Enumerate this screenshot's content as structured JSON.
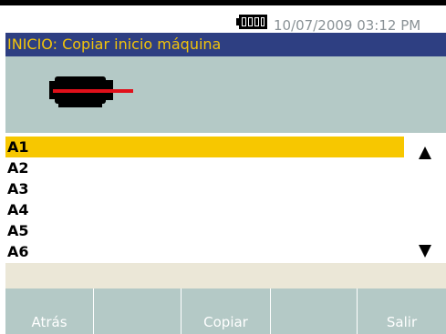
{
  "status": {
    "battery_icon": "battery-full-icon",
    "datetime": "10/07/2009 03:12 PM"
  },
  "title": "INICIO: Copiar inicio máquina",
  "picture": {
    "icon": "motor-icon"
  },
  "list": {
    "items": [
      "A1",
      "A2",
      "A3",
      "A4",
      "A5",
      "A6"
    ],
    "selected_index": 0,
    "scroll_up_icon": "triangle-up-icon",
    "scroll_down_icon": "triangle-down-icon"
  },
  "softkeys": {
    "f1": "Atrás",
    "f2": "",
    "f3": "Copiar",
    "f4": "",
    "f5": "Salir"
  },
  "colors": {
    "title_bg": "#2e3f82",
    "title_fg": "#f2c40a",
    "selection": "#f7c700",
    "panel": "#b4c9c6",
    "info_band": "#ebe7d7"
  }
}
